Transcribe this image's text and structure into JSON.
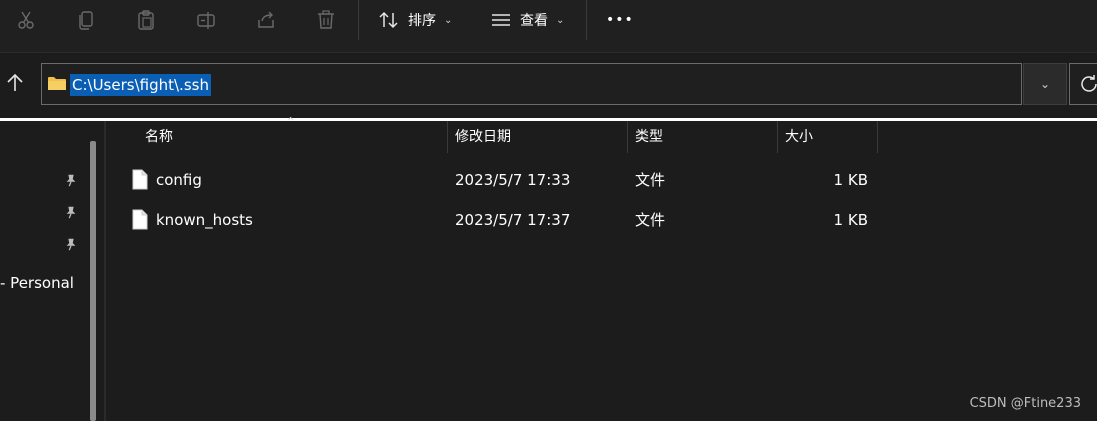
{
  "toolbar": {
    "sort_label": "排序",
    "view_label": "查看",
    "more_label": "•••"
  },
  "address": {
    "path": "C:\\Users\\fight\\.ssh"
  },
  "nav": {
    "personal_label": "- Personal"
  },
  "columns": {
    "name": "名称",
    "modified": "修改日期",
    "type": "类型",
    "size": "大小"
  },
  "files": [
    {
      "name": "config",
      "modified": "2023/5/7 17:33",
      "type": "文件",
      "size": "1 KB"
    },
    {
      "name": "known_hosts",
      "modified": "2023/5/7 17:37",
      "type": "文件",
      "size": "1 KB"
    }
  ],
  "watermark": "CSDN @Ftine233",
  "colors": {
    "background": "#1c1c1c",
    "toolbar": "#202020",
    "selection": "#0a5fb5",
    "folder": "#f0c04a"
  }
}
